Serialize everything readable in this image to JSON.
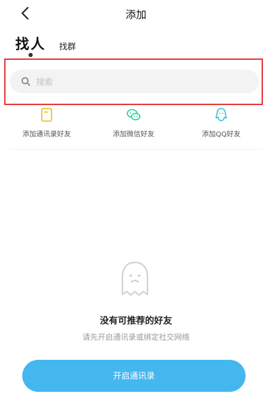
{
  "header": {
    "title": "添加",
    "back_icon": "chevron-left-icon"
  },
  "tabs": [
    {
      "label": "找人",
      "active": true
    },
    {
      "label": "找群",
      "active": false
    }
  ],
  "search": {
    "placeholder": "搜索",
    "icon": "search-icon"
  },
  "sources": [
    {
      "label": "添加通讯录好友",
      "icon": "contacts-icon",
      "color": "#f2c233"
    },
    {
      "label": "添加微信好友",
      "icon": "wechat-icon",
      "color": "#2fcf9a"
    },
    {
      "label": "添加QQ好友",
      "icon": "qq-icon",
      "color": "#33c2d6"
    }
  ],
  "empty_state": {
    "icon": "ghost-icon",
    "title": "没有可推荐的好友",
    "subtitle": "请先开启通讯录或绑定社交网络"
  },
  "cta": {
    "label": "开启通讯录",
    "color": "#45b7ef"
  },
  "colors": {
    "highlight": "#e23c3c",
    "accent": "#45b7ef"
  }
}
